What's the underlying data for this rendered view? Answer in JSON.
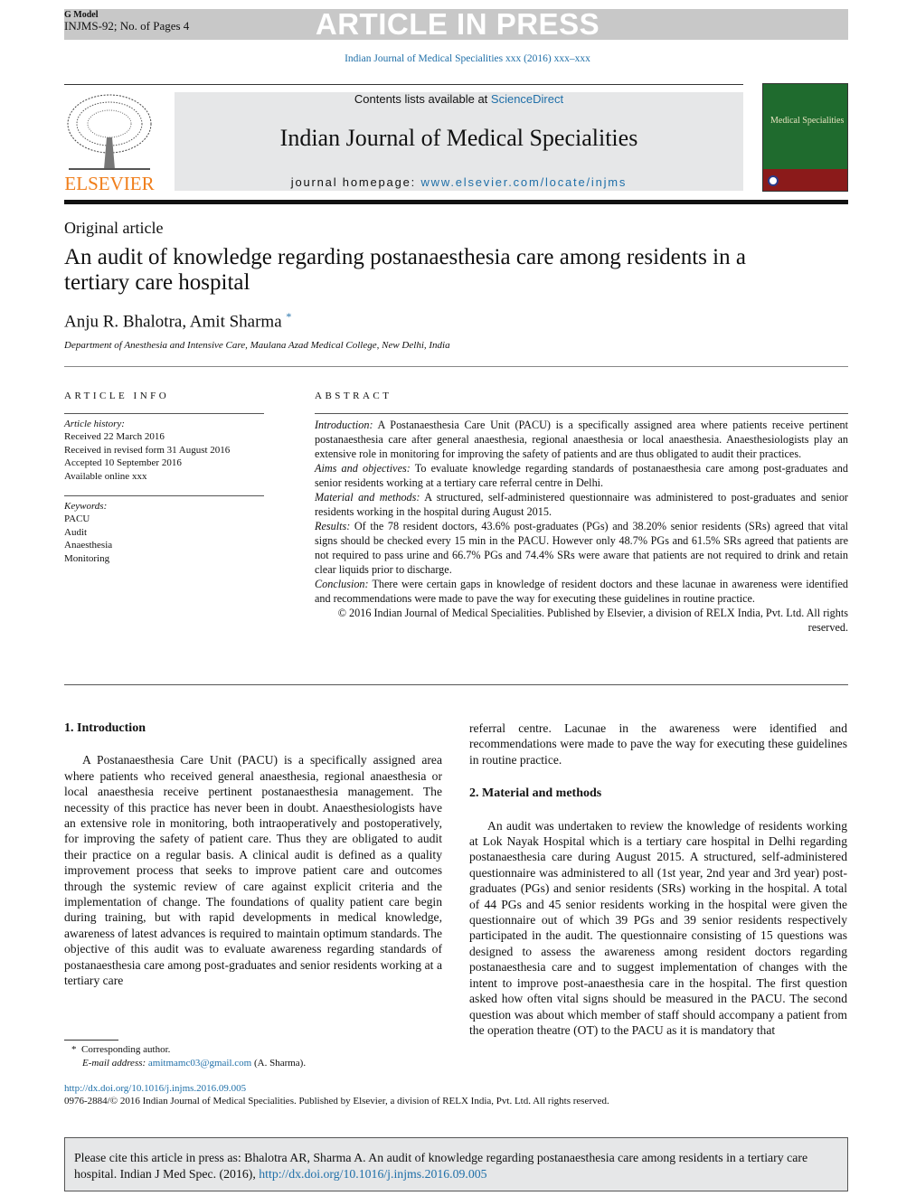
{
  "header": {
    "g_model": "G Model",
    "manuscript": "INJMS-92; No. of Pages 4",
    "press_label": "ARTICLE IN PRESS",
    "citation": "Indian Journal of Medical Specialities xxx (2016) xxx–xxx",
    "contents_prefix": "Contents lists available at ",
    "contents_link": "ScienceDirect",
    "journal_name": "Indian Journal of Medical Specialities",
    "homepage_prefix": "journal homepage: ",
    "homepage_link": "www.elsevier.com/locate/injms",
    "publisher_logo": "ELSEVIER",
    "cover_title": "Medical Specialities",
    "colors": {
      "link": "#1f6fa8",
      "elsevier": "#f07e1b",
      "banner": "#e6e7e8",
      "cover_green": "#1f6b2e",
      "cover_red": "#8b1a1a"
    }
  },
  "article": {
    "type": "Original article",
    "title": "An audit of knowledge regarding postanaesthesia care among residents in a tertiary care hospital",
    "authors": "Anju R. Bhalotra, Amit Sharma",
    "corresponding_mark": "*",
    "affiliation": "Department of Anesthesia and Intensive Care, Maulana Azad Medical College, New Delhi, India"
  },
  "article_info": {
    "heading": "ARTICLE INFO",
    "history_label": "Article history:",
    "history": [
      "Received 22 March 2016",
      "Received in revised form 31 August 2016",
      "Accepted 10 September 2016",
      "Available online xxx"
    ],
    "keywords_label": "Keywords:",
    "keywords": [
      "PACU",
      "Audit",
      "Anaesthesia",
      "Monitoring"
    ]
  },
  "abstract": {
    "heading": "ABSTRACT",
    "sections": [
      {
        "label": "Introduction:",
        "text": " A Postanaesthesia Care Unit (PACU) is a specifically assigned area where patients receive pertinent postanaesthesia care after general anaesthesia, regional anaesthesia or local anaesthesia. Anaesthesiologists play an extensive role in monitoring for improving the safety of patients and are thus obligated to audit their practices."
      },
      {
        "label": "Aims and objectives:",
        "text": " To evaluate knowledge regarding standards of postanaesthesia care among post-graduates and senior residents working at a tertiary care referral centre in Delhi."
      },
      {
        "label": "Material and methods:",
        "text": " A structured, self-administered questionnaire was administered to post-graduates and senior residents working in the hospital during August 2015."
      },
      {
        "label": "Results:",
        "text": " Of the 78 resident doctors, 43.6% post-graduates (PGs) and 38.20% senior residents (SRs) agreed that vital signs should be checked every 15 min in the PACU. However only 48.7% PGs and 61.5% SRs agreed that patients are not required to pass urine and 66.7% PGs and 74.4% SRs were aware that patients are not required to drink and retain clear liquids prior to discharge."
      },
      {
        "label": "Conclusion:",
        "text": " There were certain gaps in knowledge of resident doctors and these lacunae in awareness were identified and recommendations were made to pave the way for executing these guidelines in routine practice."
      }
    ],
    "copyright": "© 2016 Indian Journal of Medical Specialities. Published by Elsevier, a division of RELX India, Pvt. Ltd. All rights reserved."
  },
  "body": {
    "intro_heading": "1.  Introduction",
    "intro_p1": "A Postanaesthesia Care Unit (PACU) is a specifically assigned area where patients who received general anaesthesia, regional anaesthesia or local anaesthesia receive pertinent postanaesthesia management. The necessity of this practice has never been in doubt. Anaesthesiologists have an extensive role in monitoring, both intraoperatively and postoperatively, for improving the safety of patient care. Thus they are obligated to audit their practice on a regular basis. A clinical audit is defined as a quality improvement process that seeks to improve patient care and outcomes through the systemic review of care against explicit criteria and the implementation of change. The foundations of quality patient care begin during training, but with rapid developments in medical knowledge, awareness of latest advances is required to maintain optimum standards. The objective of this audit was to evaluate awareness regarding standards of postanaesthesia care among post-graduates and senior residents working at a tertiary care",
    "intro_cont": "referral centre. Lacunae in the awareness were identified and recommendations were made to pave the way for executing these guidelines in routine practice.",
    "methods_heading": "2.  Material and methods",
    "methods_p1": "An audit was undertaken to review the knowledge of residents working at Lok Nayak Hospital which is a tertiary care hospital in Delhi regarding postanaesthesia care during August 2015. A structured, self-administered questionnaire was administered to all (1st year, 2nd year and 3rd year) post-graduates (PGs) and senior residents (SRs) working in the hospital. A total of 44 PGs and 45 senior residents working in the hospital were given the questionnaire out of which 39 PGs and 39 senior residents respectively participated in the audit. The questionnaire consisting of 15 questions was designed to assess the awareness among resident doctors regarding postanaesthesia care and to suggest implementation of changes with the intent to improve post-anaesthesia care in the hospital. The first question asked how often vital signs should be measured in the PACU. The second question was about which member of staff should accompany a patient from the operation theatre (OT) to the PACU as it is mandatory that"
  },
  "footnote": {
    "mark": "*",
    "label": "Corresponding author.",
    "email_label": "E-mail address:",
    "email": "amitmamc03@gmail.com",
    "email_suffix": " (A. Sharma)."
  },
  "footer": {
    "doi": "http://dx.doi.org/10.1016/j.injms.2016.09.005",
    "issn": "0976-2884/© 2016 Indian Journal of Medical Specialities. Published by Elsevier, a division of RELX India, Pvt. Ltd. All rights reserved.",
    "cite_text": "Please cite this article in press as: Bhalotra AR, Sharma A. An audit of knowledge regarding postanaesthesia care among residents in a tertiary care hospital. Indian J Med Spec. (2016), ",
    "cite_link": "http://dx.doi.org/10.1016/j.injms.2016.09.005"
  }
}
